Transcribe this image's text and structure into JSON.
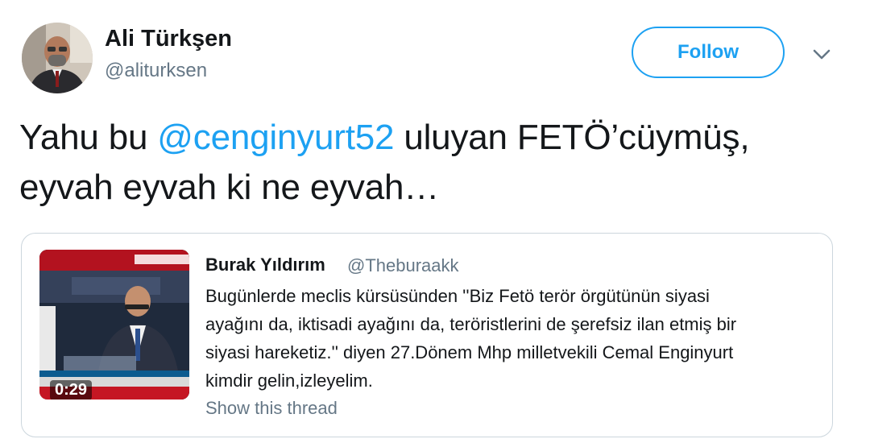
{
  "author": {
    "display_name": "Ali Türkşen",
    "handle": "@aliturksen",
    "avatar_icon": "profile-photo"
  },
  "follow_label": "Follow",
  "menu_icon": "chevron-down-icon",
  "tweet": {
    "line1_before": "Yahu bu ",
    "mention": "@cenginyurt52",
    "line1_after": " uluyan FETÖ’cüymüş,",
    "line2": "eyvah eyvah ki ne eyvah…"
  },
  "quoted": {
    "display_name": "Burak Yıldırım",
    "handle": "@Theburaakk",
    "body_lines": [
      "Bugünlerde meclis kürsüsünden ''Biz Fetö terör örgütünün siyasi",
      "ayağını da, iktisadi ayağını da, teröristlerini de şerefsiz ilan etmiş bir",
      "siyasi hareketiz.'' diyen 27.Dönem Mhp milletvekili Cemal Enginyurt",
      "kimdir gelin,izleyelim."
    ],
    "video_duration": "0:29",
    "show_thread": "Show this thread"
  },
  "colors": {
    "accent": "#1da1f2",
    "secondary_text": "#657786",
    "border": "#ccd6dd",
    "primary_text": "#14171a"
  }
}
